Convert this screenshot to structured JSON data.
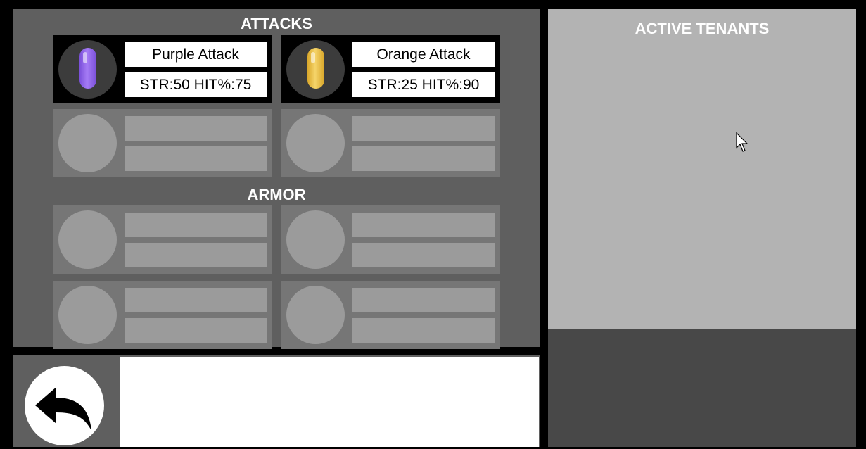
{
  "inventory": {
    "attacks_title": "ATTACKS",
    "armor_title": "ARMOR",
    "attacks": [
      {
        "name": "Purple Attack",
        "stats": "STR:50 HIT%:75",
        "color": "#9b6cf0",
        "icon": "purple-capsule-icon"
      },
      {
        "name": "Orange Attack",
        "stats": "STR:25 HIT%:90",
        "color": "#f0c542",
        "icon": "orange-capsule-icon"
      }
    ],
    "empty_attack_slots": 2,
    "empty_armor_slots": 4
  },
  "tenants": {
    "title": "ACTIVE TENANTS"
  },
  "controls": {
    "back_icon": "back-arrow-icon"
  },
  "colors": {
    "panel": "#5f5f5f",
    "empty_slot": "#767676",
    "tenants_bg": "#b3b3b3",
    "tenants_footer": "#484848"
  }
}
